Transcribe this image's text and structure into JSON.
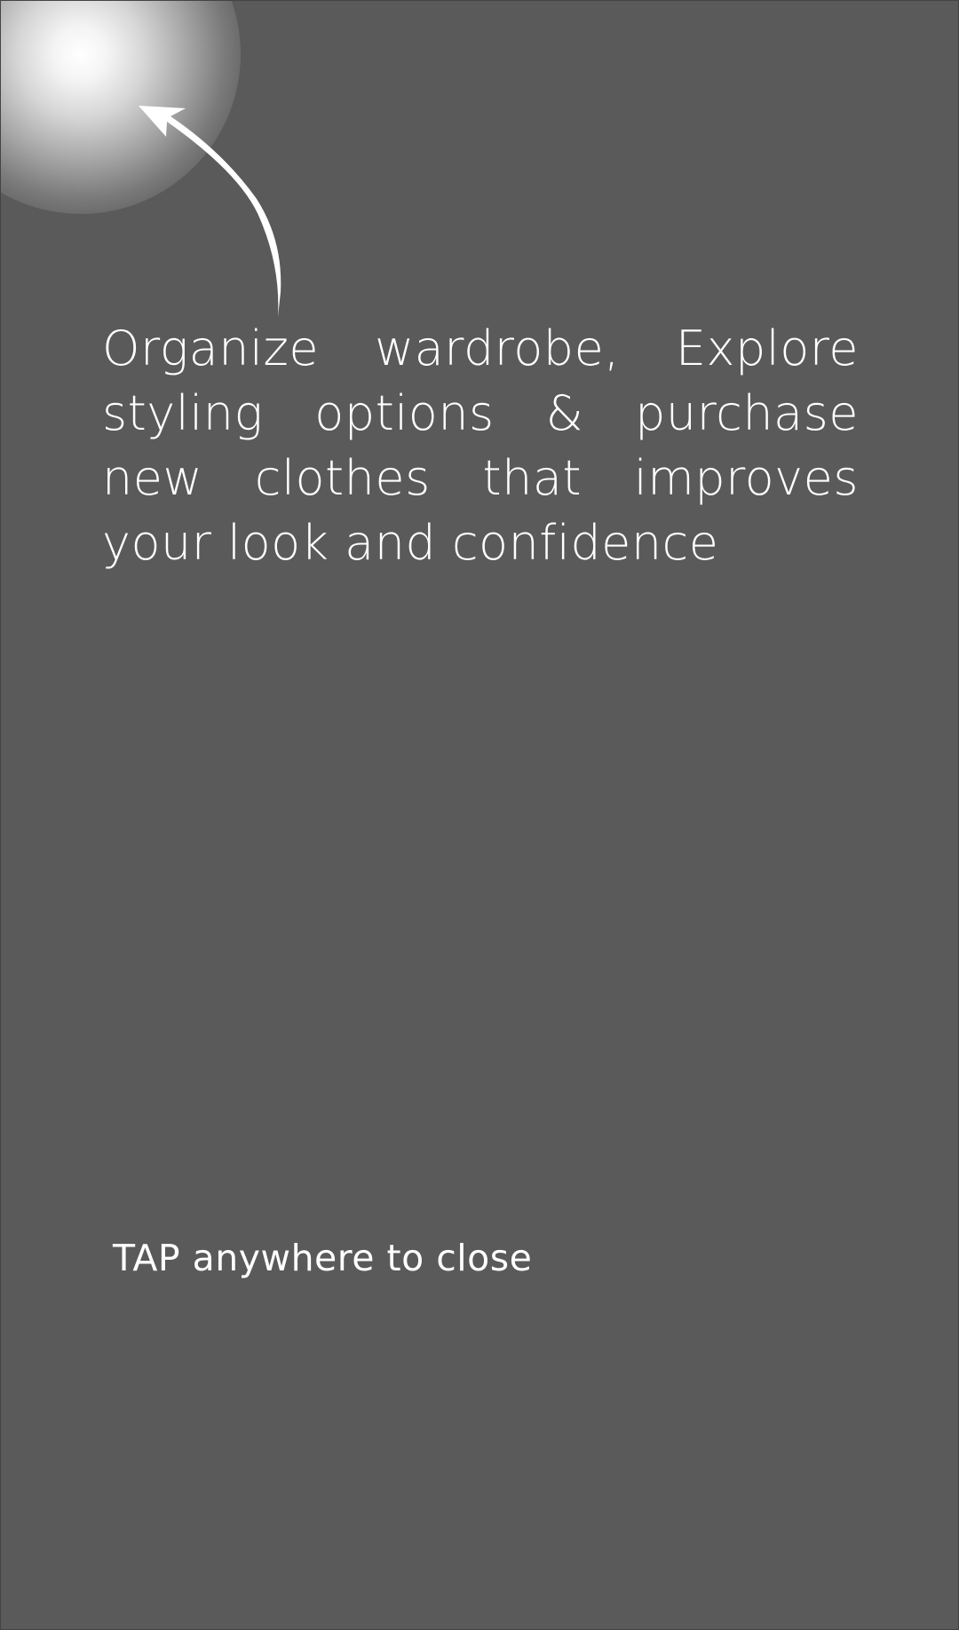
{
  "tutorial": {
    "message": "Organize wardrobe, Explore styling options & purchase new clothes that improves your look and confidence",
    "close_hint": "TAP anywhere to close"
  },
  "colors": {
    "overlay": "#5a5a5a",
    "text": "#ffffff",
    "spotlight": "#ffffff"
  },
  "icons": {
    "pointer": "curved-arrow-icon"
  }
}
